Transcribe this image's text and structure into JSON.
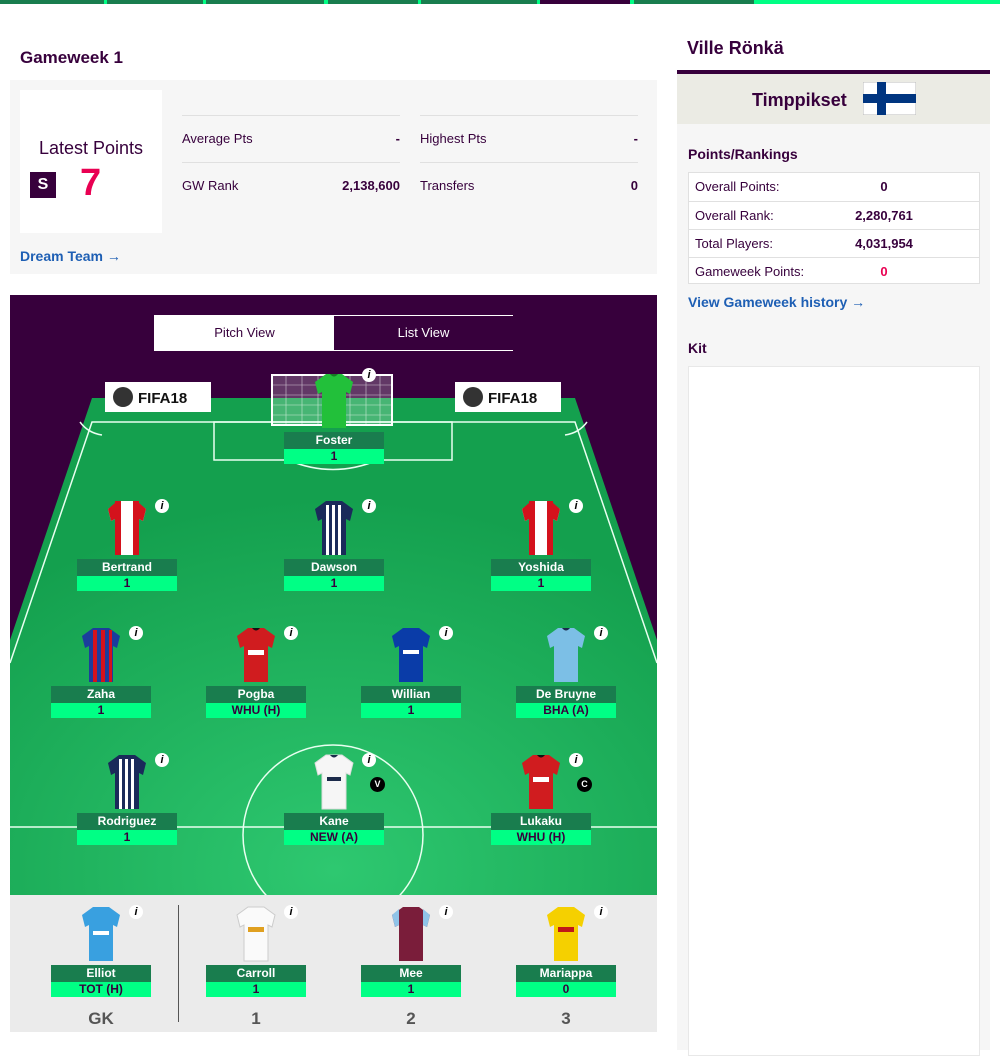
{
  "colors": {
    "primary": "#37003c",
    "accent": "#00ff85",
    "pink": "#e90052",
    "link": "#1e5fb4",
    "pitch": "#1ea55a"
  },
  "gameweek": {
    "title": "Gameweek 1"
  },
  "summary": {
    "latest_points_label": "Latest Points",
    "latest_points_value": "7",
    "stats": [
      {
        "label": "Average Pts",
        "value": "-"
      },
      {
        "label": "Highest Pts",
        "value": "-"
      },
      {
        "label": "GW Rank",
        "value": "2,138,600"
      },
      {
        "label": "Transfers",
        "value": "0"
      }
    ],
    "dream_team_link": "Dream Team →"
  },
  "view_toggle": {
    "pitch": "Pitch View",
    "list": "List View",
    "active": "pitch"
  },
  "sponsor_boards": [
    "FIFA18",
    "FIFA18"
  ],
  "players": {
    "goalkeeper": [
      {
        "name": "Foster",
        "fixture": "1",
        "kit": "gk-green"
      }
    ],
    "defenders": [
      {
        "name": "Bertrand",
        "fixture": "1",
        "kit": "southampton"
      },
      {
        "name": "Dawson",
        "fixture": "1",
        "kit": "westbrom"
      },
      {
        "name": "Yoshida",
        "fixture": "1",
        "kit": "southampton"
      }
    ],
    "midfielders": [
      {
        "name": "Zaha",
        "fixture": "1",
        "kit": "palace"
      },
      {
        "name": "Pogba",
        "fixture": "WHU (H)",
        "kit": "manutd"
      },
      {
        "name": "Willian",
        "fixture": "1",
        "kit": "chelsea"
      },
      {
        "name": "De Bruyne",
        "fixture": "BHA (A)",
        "kit": "mancity"
      }
    ],
    "forwards": [
      {
        "name": "Rodriguez",
        "fixture": "1",
        "kit": "westbrom"
      },
      {
        "name": "Kane",
        "fixture": "NEW (A)",
        "kit": "spurs",
        "badge": "V"
      },
      {
        "name": "Lukaku",
        "fixture": "WHU (H)",
        "kit": "manutd",
        "badge": "C"
      }
    ],
    "bench": [
      {
        "name": "Elliot",
        "fixture": "TOT (H)",
        "kit": "gk-blue",
        "position": "GK"
      },
      {
        "name": "Carroll",
        "fixture": "1",
        "kit": "swansea",
        "position": "1"
      },
      {
        "name": "Mee",
        "fixture": "1",
        "kit": "burnley",
        "position": "2"
      },
      {
        "name": "Mariappa",
        "fixture": "0",
        "kit": "watford",
        "position": "3"
      }
    ]
  },
  "info_icon": "i",
  "manager": {
    "name": "Ville Rönkä"
  },
  "team": {
    "name": "Timppikset",
    "flag": "finland"
  },
  "rankings": {
    "heading": "Points/Rankings",
    "rows": [
      {
        "label": "Overall Points:",
        "value": "0"
      },
      {
        "label": "Overall Rank:",
        "value": "2,280,761"
      },
      {
        "label": "Total Players:",
        "value": "4,031,954"
      },
      {
        "label": "Gameweek Points:",
        "value": "0"
      }
    ],
    "history_link": "View Gameweek history →"
  },
  "kit": {
    "heading": "Kit"
  }
}
